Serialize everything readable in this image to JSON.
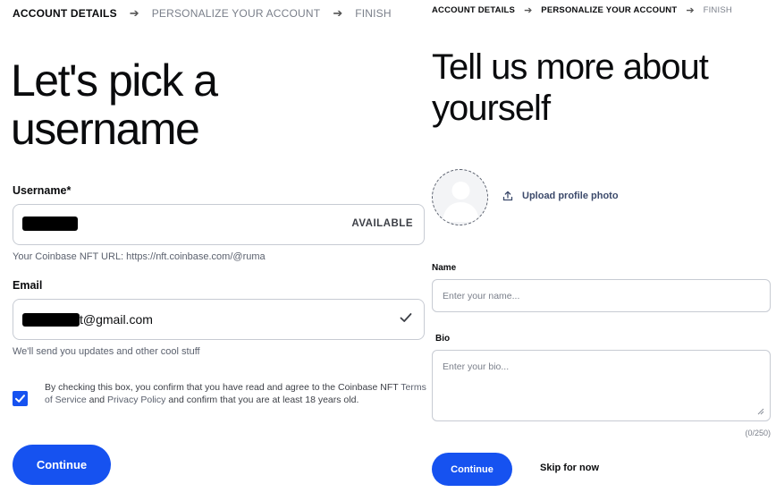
{
  "username_step": {
    "steps": [
      "ACCOUNT DETAILS",
      "PERSONALIZE YOUR ACCOUNT",
      "FINISH"
    ],
    "title": "Let's pick a username",
    "username": {
      "label": "Username*",
      "status": "AVAILABLE",
      "helper": "Your Coinbase NFT URL: https://nft.coinbase.com/@ruma"
    },
    "email": {
      "label": "Email",
      "value_visible": "t@gmail.com",
      "helper": "We'll send you updates and other cool stuff"
    },
    "consent": {
      "checked": true,
      "text_1": "By checking this box, you confirm that you have read and agree to the Coinbase NFT ",
      "terms_link": "Terms of Service",
      "text_2": " and ",
      "privacy_link": "Privacy Policy",
      "text_3": " and confirm that you are at least 18 years old."
    },
    "continue_label": "Continue"
  },
  "profile_step": {
    "steps": [
      "ACCOUNT DETAILS",
      "PERSONALIZE YOUR ACCOUNT",
      "FINISH"
    ],
    "title": "Tell us more about yourself",
    "upload_label": "Upload profile photo",
    "name": {
      "label": "Name",
      "placeholder": "Enter your name..."
    },
    "bio": {
      "label": "Bio",
      "placeholder": "Enter your bio...",
      "counter": "(0/250)"
    },
    "continue_label": "Continue",
    "skip_label": "Skip for now"
  },
  "icons": {
    "step_arrow": "arrow-right-icon",
    "email_valid": "checkmark-icon",
    "consent_box": "checkbox-checked-icon",
    "upload": "upload-icon",
    "avatar": "user-silhouette-icon",
    "bio_resize": "resize-handle-icon"
  },
  "colors": {
    "primary": "#1652f0",
    "text": "#0a0b0d",
    "muted": "#5b616e",
    "border": "#c7cbd3"
  }
}
